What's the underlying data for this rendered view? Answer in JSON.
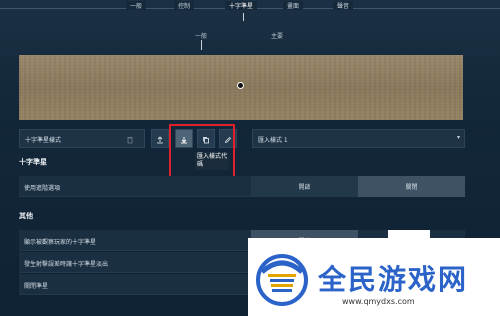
{
  "top_tabs": [
    {
      "label": "一般"
    },
    {
      "label": "控制"
    },
    {
      "label": "十字準星",
      "active": true
    },
    {
      "label": "畫面"
    },
    {
      "label": "聲音"
    }
  ],
  "sub_tabs": [
    {
      "label": "一般",
      "active": true
    },
    {
      "label": "主要"
    }
  ],
  "code_row": {
    "field_label": "十字準星樣式",
    "preset_value": "匯入樣式 1",
    "tooltip": "匯入樣式代碼",
    "icons": [
      "delete-icon",
      "upload-icon",
      "download-icon",
      "copy-icon",
      "edit-icon"
    ]
  },
  "section_crosshair": {
    "title": "十字準星",
    "rows": [
      {
        "label": "使用進階選項",
        "on_label": "開啟",
        "off_label": "關閉",
        "selected": "off"
      }
    ]
  },
  "section_other": {
    "title": "其他",
    "rows": [
      {
        "label": "顯示被觀察玩家的十字準星",
        "on_label": "開啟",
        "selected": "on"
      },
      {
        "label": "發生射擊誤差時讓十字準星淡出",
        "on_label": "",
        "selected": "on"
      },
      {
        "label": "關閉準星",
        "on_label": "",
        "selected": "on"
      }
    ]
  },
  "watermark": {
    "title": "全民游戏网",
    "url": "www.qmydxs.com"
  },
  "colors": {
    "highlight": "#e0202a",
    "watermark_blue": "#2b63c8"
  }
}
